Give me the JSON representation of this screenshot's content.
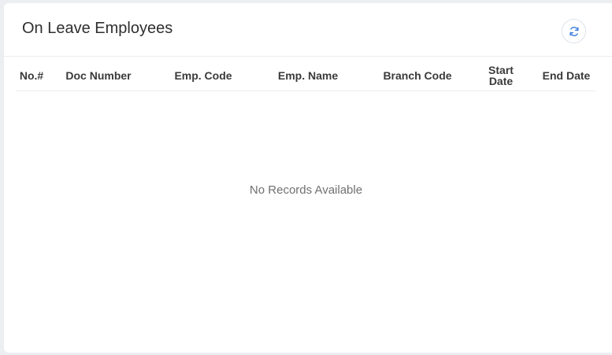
{
  "panel": {
    "title": "On Leave Employees",
    "refresh_icon": "refresh-icon"
  },
  "colors": {
    "accent": "#3b7ddd",
    "title_text": "#2f2f2f",
    "empty_text": "#707070"
  },
  "table": {
    "columns": [
      "No.#",
      "Doc Number",
      "Emp. Code",
      "Emp. Name",
      "Branch Code",
      "Start Date",
      "End Date"
    ],
    "rows": [],
    "empty_message": "No Records Available"
  }
}
